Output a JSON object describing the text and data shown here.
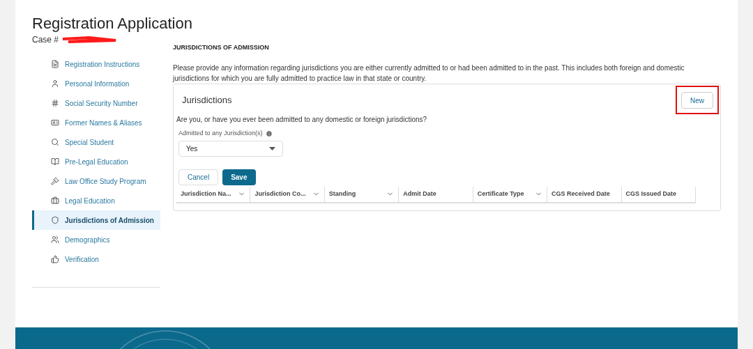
{
  "header": {
    "title": "Registration Application",
    "case_label": "Case #"
  },
  "sidebar": {
    "items": [
      {
        "label": "Registration Instructions",
        "selected": false
      },
      {
        "label": "Personal Information",
        "selected": false
      },
      {
        "label": "Social Security Number",
        "selected": false
      },
      {
        "label": "Former Names & Aliases",
        "selected": false
      },
      {
        "label": "Special Student",
        "selected": false
      },
      {
        "label": "Pre-Legal Education",
        "selected": false
      },
      {
        "label": "Law Office Study Program",
        "selected": false
      },
      {
        "label": "Legal Education",
        "selected": false
      },
      {
        "label": "Jurisdictions of Admission",
        "selected": true
      },
      {
        "label": "Demographics",
        "selected": false
      },
      {
        "label": "Verification",
        "selected": false
      }
    ]
  },
  "section": {
    "heading": "JURISDICTIONS OF ADMISSION",
    "intro": "Please provide any information regarding jurisdictions you are either currently admitted to or had been admitted to in the past. This includes both foreign and domestic jurisdictions for which you are fully admitted to practice law in that state or country.",
    "card": {
      "title": "Jurisdictions",
      "new_button": "New",
      "new_highlighted": true,
      "question": "Are you, or have you ever been admitted to any domestic or foreign jurisdictions?",
      "select": {
        "label": "Admitted to any Jurisdiction(s)",
        "value": "Yes"
      },
      "buttons": [
        {
          "label": "Cancel",
          "kind": "secondary"
        },
        {
          "label": "Save",
          "kind": "primary"
        }
      ],
      "table": {
        "columns": [
          {
            "label": "Jurisdiction Na...",
            "menu": true
          },
          {
            "label": "Jurisdiction Co...",
            "menu": true
          },
          {
            "label": "Standing",
            "menu": true
          },
          {
            "label": "Admit Date",
            "menu": false
          },
          {
            "label": "Certificate Type",
            "menu": true
          },
          {
            "label": "CGS Received Date",
            "menu": false
          },
          {
            "label": "CGS Issued Date",
            "menu": false
          }
        ]
      }
    }
  }
}
